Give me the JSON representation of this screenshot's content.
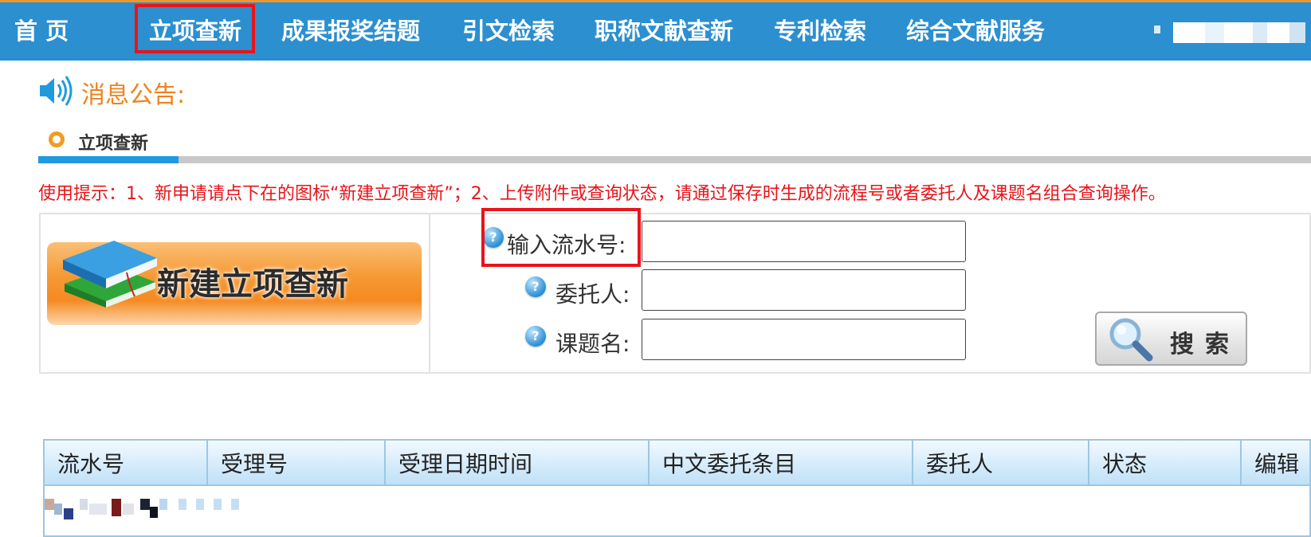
{
  "nav": {
    "items": [
      "首 页",
      "立项查新",
      "成果报奖结题",
      "引文检索",
      "职称文献查新",
      "专利检索",
      "综合文献服务"
    ],
    "active": "立项查新"
  },
  "notice": {
    "label": "消息公告:"
  },
  "section": {
    "title": "立项查新"
  },
  "tip": "使用提示：1、新申请请点下在的图标“新建立项查新”；2、上传附件或查询状态，请通过保存时生成的流程号或者委托人及课题名组合查询操作。",
  "new_button": {
    "label": "新建立项查新"
  },
  "form": {
    "serial_label": "输入流水号:",
    "client_label": "委托人:",
    "topic_label": "课题名:",
    "serial_value": "",
    "client_value": "",
    "topic_value": ""
  },
  "search_button": {
    "label": "搜索"
  },
  "table": {
    "headers": [
      "流水号",
      "受理号",
      "受理日期时间",
      "中文委托条目",
      "委托人",
      "状态",
      "编辑"
    ]
  },
  "colors": {
    "nav_bg": "#2b8fd0",
    "accent_orange": "#f0962f",
    "notice_text": "#ef8220",
    "tip_text": "#e8141a",
    "highlight_box": "#e8141a"
  }
}
